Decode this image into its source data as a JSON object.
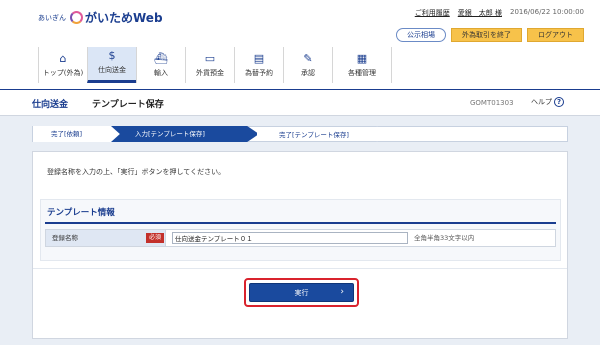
{
  "header": {
    "logo_prefix": "あいぎん",
    "logo_text": "がいためWeb",
    "usage_history": "ご利用履歴",
    "user_name": "愛銀　太郎 様",
    "timestamp": "2016/06/22 10:00:00",
    "btn_public_rates": "公示相場",
    "btn_end_fx": "外為取引を終了",
    "btn_logout": "ログアウト"
  },
  "gnav": [
    {
      "label": "トップ(外為)",
      "icon": "home-icon",
      "glyph": "⌂"
    },
    {
      "label": "仕向送金",
      "icon": "remittance-icon",
      "glyph": "$"
    },
    {
      "label": "輸入",
      "icon": "import-icon",
      "glyph": "⛴"
    },
    {
      "label": "外貨預金",
      "icon": "deposit-icon",
      "glyph": "▭"
    },
    {
      "label": "為替予約",
      "icon": "reservation-icon",
      "glyph": "▤"
    },
    {
      "label": "承認",
      "icon": "approval-icon",
      "glyph": "✎"
    },
    {
      "label": "各種管理",
      "icon": "management-icon",
      "glyph": "▦"
    }
  ],
  "titlebar": {
    "section": "仕向送金",
    "title": "テンプレート保存",
    "screen_code": "GOMT01303",
    "help": "ヘルプ"
  },
  "steps": [
    "完了[依頼]",
    "入力[テンプレート保存]",
    "完了[テンプレート保存]"
  ],
  "main": {
    "instruction": "登録名称を入力の上、「実行」ボタンを押してください。",
    "section_title": "テンプレート情報",
    "field_label": "登録名称",
    "required": "必須",
    "field_value": "仕向送金テンプレート０１",
    "field_hint": "全角半角33文字以内",
    "execute_label": "実行"
  }
}
